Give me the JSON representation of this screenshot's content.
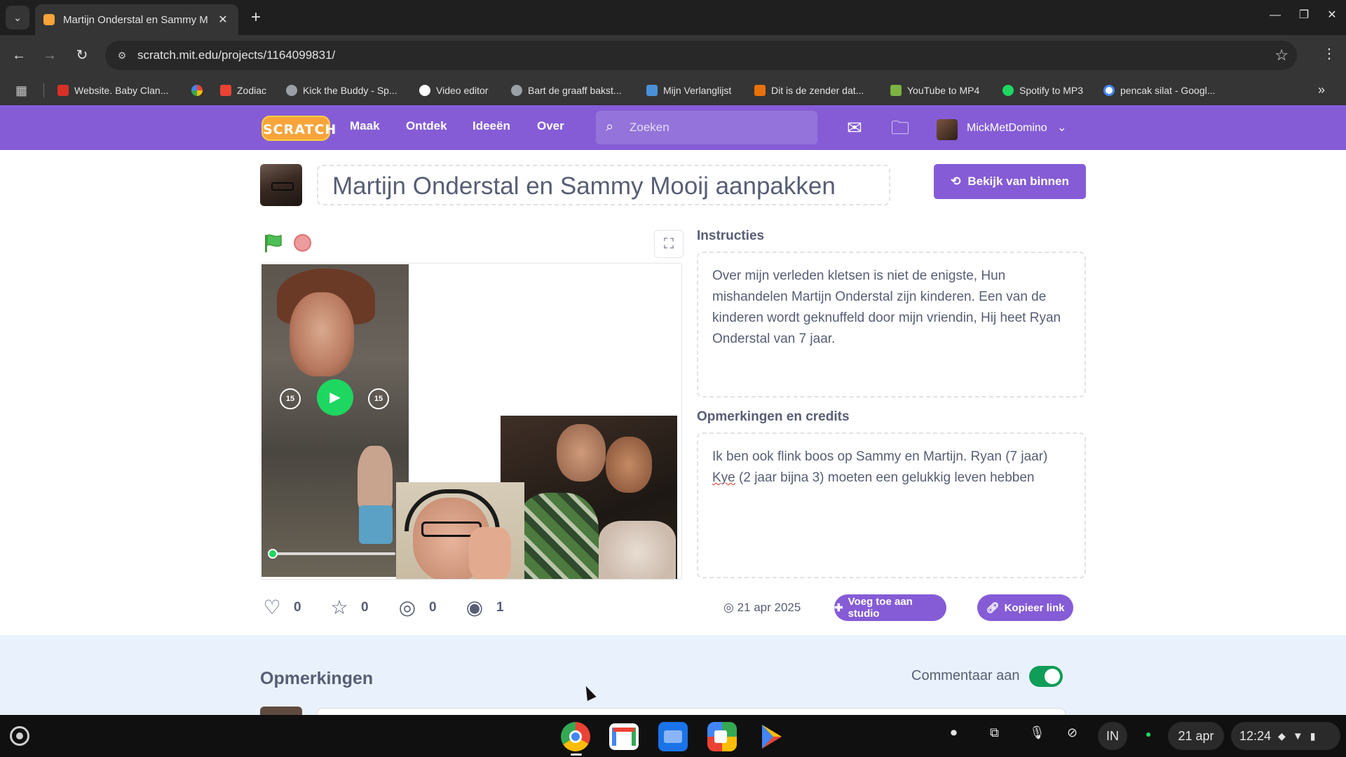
{
  "browser": {
    "tab_title": "Martijn Onderstal en Sammy M",
    "url": "scratch.mit.edu/projects/1164099831/",
    "bookmarks": [
      {
        "label": "Website. Baby Clan...",
        "color": "#d93025"
      },
      {
        "label": "",
        "color": "#f4b400"
      },
      {
        "label": "Zodiac",
        "color": "#e94235"
      },
      {
        "label": "Kick the Buddy - Sp...",
        "color": "#9aa0a6"
      },
      {
        "label": "Video editor",
        "color": "#ffffff"
      },
      {
        "label": "Bart de graaff bakst...",
        "color": "#9aa0a6"
      },
      {
        "label": "Mijn Verlanglijst",
        "color": "#4a90d9"
      },
      {
        "label": "Dit is de zender dat...",
        "color": "#e8710a"
      },
      {
        "label": "YouTube to MP4",
        "color": "#7cb342"
      },
      {
        "label": "Spotify to MP3",
        "color": "#1ed760"
      },
      {
        "label": "pencak silat - Googl...",
        "color": "#4285f4"
      }
    ]
  },
  "nav": {
    "logo": "SCRATCH",
    "links": [
      "Maak",
      "Ontdek",
      "Ideeën",
      "Over"
    ],
    "search_placeholder": "Zoeken",
    "username": "MickMetDomino"
  },
  "project": {
    "title": "Martijn Onderstal en Sammy Mooij aanpakken",
    "see_inside": "Bekijk van binnen",
    "instructions_heading": "Instructies",
    "instructions": "Over mijn verleden kletsen is niet de enigste, Hun mishandelen Martijn Onderstal zijn kinderen. Een van de kinderen wordt geknuffeld door mijn vriendin, Hij heet Ryan Onderstal van 7 jaar.",
    "credits_heading": "Opmerkingen en credits",
    "credits_part1": "Ik ben ook flink boos op Sammy en Martijn. Ryan (7 jaar) ",
    "credits_misspelled": "Kye",
    "credits_part2": " (2 jaar bijna 3) moeten een gelukkig leven hebben",
    "video_skip_back": "15",
    "video_skip_fwd": "15",
    "video_progress": 0.04,
    "stats": {
      "loves": "0",
      "favorites": "0",
      "remixes": "0",
      "views": "1"
    },
    "share_date": "21 apr 2025",
    "add_to_studio": "Voeg toe aan studio",
    "copy_link": "Kopieer link"
  },
  "comments": {
    "heading": "Opmerkingen",
    "toggle_label": "Commentaar aan",
    "enabled": true
  },
  "shelf": {
    "ime": "IN",
    "date": "21 apr",
    "time": "12:24"
  }
}
